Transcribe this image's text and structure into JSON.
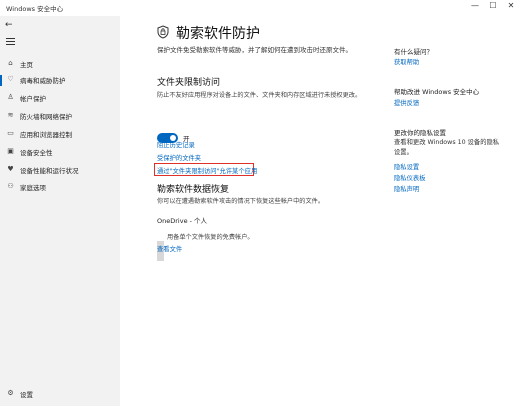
{
  "window": {
    "title": "Windows 安全中心",
    "min_glyph": "—",
    "max_glyph": "☐",
    "close_glyph": "✕"
  },
  "sidebar": {
    "back_glyph": "←",
    "items": [
      {
        "label": "主页",
        "icon": "home-icon",
        "glyph": "⌂"
      },
      {
        "label": "病毒和威胁防护",
        "icon": "shield-heart-icon",
        "glyph": "♡"
      },
      {
        "label": "帐户保护",
        "icon": "person-icon",
        "glyph": "♙"
      },
      {
        "label": "防火墙和网络保护",
        "icon": "wifi-icon",
        "glyph": "≋"
      },
      {
        "label": "应用和浏览器控制",
        "icon": "app-window-icon",
        "glyph": "▭"
      },
      {
        "label": "设备安全性",
        "icon": "laptop-icon",
        "glyph": "▣"
      },
      {
        "label": "设备性能和运行状况",
        "icon": "heart-pulse-icon",
        "glyph": "♥"
      },
      {
        "label": "家庭选项",
        "icon": "family-icon",
        "glyph": "⚇"
      }
    ],
    "settings": {
      "label": "设置",
      "icon": "gear-icon",
      "glyph": "⚙"
    }
  },
  "main": {
    "title": "勒索软件防护",
    "description": "保护文件免受勒索软件等威胁，并了解如何在遭到攻击时还原文件。",
    "cfa": {
      "title": "文件夹限制访问",
      "description": "防止不友好应用程序对设备上的文件、文件夹和内存区域进行未授权更改。",
      "toggle_state": "开",
      "toggle_on": true
    },
    "links": {
      "block_history": "阻止历史记录",
      "protected_folders": "受保护的文件夹",
      "allow_app": "通过\"文件夹限制访问\"允许某个应用"
    },
    "recovery": {
      "title": "勒索软件数据恢复",
      "description": "你可以在遭遇勒索软件攻击的情况下恢复这些帐户中的文件。",
      "onedrive": "OneDrive - 个人",
      "onedrive_desc": "用备单个文件恢复的免费帐户。",
      "view_files": "查看文件"
    }
  },
  "right": {
    "question": {
      "title": "有什么疑问？",
      "link": "获取帮助"
    },
    "improve": {
      "title": "帮助改进 Windows 安全中心",
      "link": "提供反馈"
    },
    "privacy": {
      "title": "更改你的隐私设置",
      "text": "查看和更改 Windows 10 设备的隐私设置。",
      "links": [
        "隐私设置",
        "隐私仪表板",
        "隐私声明"
      ]
    }
  }
}
